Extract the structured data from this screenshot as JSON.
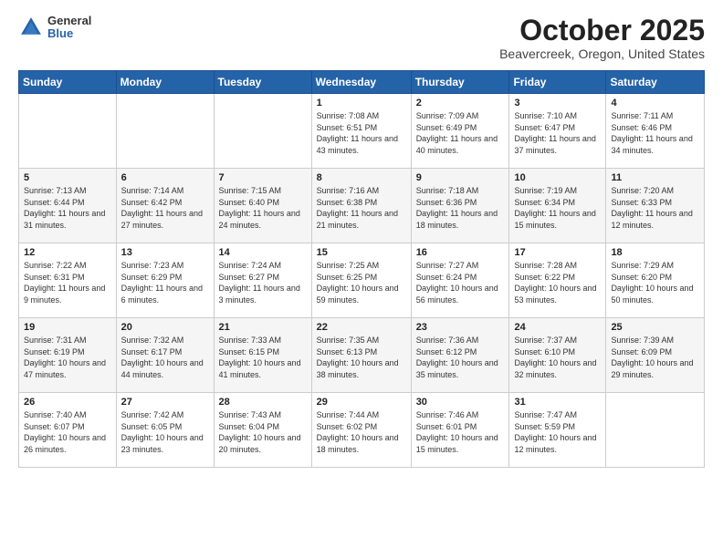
{
  "logo": {
    "general": "General",
    "blue": "Blue"
  },
  "header": {
    "month": "October 2025",
    "location": "Beavercreek, Oregon, United States"
  },
  "weekdays": [
    "Sunday",
    "Monday",
    "Tuesday",
    "Wednesday",
    "Thursday",
    "Friday",
    "Saturday"
  ],
  "weeks": [
    [
      {
        "day": "",
        "sunrise": "",
        "sunset": "",
        "daylight": ""
      },
      {
        "day": "",
        "sunrise": "",
        "sunset": "",
        "daylight": ""
      },
      {
        "day": "",
        "sunrise": "",
        "sunset": "",
        "daylight": ""
      },
      {
        "day": "1",
        "sunrise": "Sunrise: 7:08 AM",
        "sunset": "Sunset: 6:51 PM",
        "daylight": "Daylight: 11 hours and 43 minutes."
      },
      {
        "day": "2",
        "sunrise": "Sunrise: 7:09 AM",
        "sunset": "Sunset: 6:49 PM",
        "daylight": "Daylight: 11 hours and 40 minutes."
      },
      {
        "day": "3",
        "sunrise": "Sunrise: 7:10 AM",
        "sunset": "Sunset: 6:47 PM",
        "daylight": "Daylight: 11 hours and 37 minutes."
      },
      {
        "day": "4",
        "sunrise": "Sunrise: 7:11 AM",
        "sunset": "Sunset: 6:46 PM",
        "daylight": "Daylight: 11 hours and 34 minutes."
      }
    ],
    [
      {
        "day": "5",
        "sunrise": "Sunrise: 7:13 AM",
        "sunset": "Sunset: 6:44 PM",
        "daylight": "Daylight: 11 hours and 31 minutes."
      },
      {
        "day": "6",
        "sunrise": "Sunrise: 7:14 AM",
        "sunset": "Sunset: 6:42 PM",
        "daylight": "Daylight: 11 hours and 27 minutes."
      },
      {
        "day": "7",
        "sunrise": "Sunrise: 7:15 AM",
        "sunset": "Sunset: 6:40 PM",
        "daylight": "Daylight: 11 hours and 24 minutes."
      },
      {
        "day": "8",
        "sunrise": "Sunrise: 7:16 AM",
        "sunset": "Sunset: 6:38 PM",
        "daylight": "Daylight: 11 hours and 21 minutes."
      },
      {
        "day": "9",
        "sunrise": "Sunrise: 7:18 AM",
        "sunset": "Sunset: 6:36 PM",
        "daylight": "Daylight: 11 hours and 18 minutes."
      },
      {
        "day": "10",
        "sunrise": "Sunrise: 7:19 AM",
        "sunset": "Sunset: 6:34 PM",
        "daylight": "Daylight: 11 hours and 15 minutes."
      },
      {
        "day": "11",
        "sunrise": "Sunrise: 7:20 AM",
        "sunset": "Sunset: 6:33 PM",
        "daylight": "Daylight: 11 hours and 12 minutes."
      }
    ],
    [
      {
        "day": "12",
        "sunrise": "Sunrise: 7:22 AM",
        "sunset": "Sunset: 6:31 PM",
        "daylight": "Daylight: 11 hours and 9 minutes."
      },
      {
        "day": "13",
        "sunrise": "Sunrise: 7:23 AM",
        "sunset": "Sunset: 6:29 PM",
        "daylight": "Daylight: 11 hours and 6 minutes."
      },
      {
        "day": "14",
        "sunrise": "Sunrise: 7:24 AM",
        "sunset": "Sunset: 6:27 PM",
        "daylight": "Daylight: 11 hours and 3 minutes."
      },
      {
        "day": "15",
        "sunrise": "Sunrise: 7:25 AM",
        "sunset": "Sunset: 6:25 PM",
        "daylight": "Daylight: 10 hours and 59 minutes."
      },
      {
        "day": "16",
        "sunrise": "Sunrise: 7:27 AM",
        "sunset": "Sunset: 6:24 PM",
        "daylight": "Daylight: 10 hours and 56 minutes."
      },
      {
        "day": "17",
        "sunrise": "Sunrise: 7:28 AM",
        "sunset": "Sunset: 6:22 PM",
        "daylight": "Daylight: 10 hours and 53 minutes."
      },
      {
        "day": "18",
        "sunrise": "Sunrise: 7:29 AM",
        "sunset": "Sunset: 6:20 PM",
        "daylight": "Daylight: 10 hours and 50 minutes."
      }
    ],
    [
      {
        "day": "19",
        "sunrise": "Sunrise: 7:31 AM",
        "sunset": "Sunset: 6:19 PM",
        "daylight": "Daylight: 10 hours and 47 minutes."
      },
      {
        "day": "20",
        "sunrise": "Sunrise: 7:32 AM",
        "sunset": "Sunset: 6:17 PM",
        "daylight": "Daylight: 10 hours and 44 minutes."
      },
      {
        "day": "21",
        "sunrise": "Sunrise: 7:33 AM",
        "sunset": "Sunset: 6:15 PM",
        "daylight": "Daylight: 10 hours and 41 minutes."
      },
      {
        "day": "22",
        "sunrise": "Sunrise: 7:35 AM",
        "sunset": "Sunset: 6:13 PM",
        "daylight": "Daylight: 10 hours and 38 minutes."
      },
      {
        "day": "23",
        "sunrise": "Sunrise: 7:36 AM",
        "sunset": "Sunset: 6:12 PM",
        "daylight": "Daylight: 10 hours and 35 minutes."
      },
      {
        "day": "24",
        "sunrise": "Sunrise: 7:37 AM",
        "sunset": "Sunset: 6:10 PM",
        "daylight": "Daylight: 10 hours and 32 minutes."
      },
      {
        "day": "25",
        "sunrise": "Sunrise: 7:39 AM",
        "sunset": "Sunset: 6:09 PM",
        "daylight": "Daylight: 10 hours and 29 minutes."
      }
    ],
    [
      {
        "day": "26",
        "sunrise": "Sunrise: 7:40 AM",
        "sunset": "Sunset: 6:07 PM",
        "daylight": "Daylight: 10 hours and 26 minutes."
      },
      {
        "day": "27",
        "sunrise": "Sunrise: 7:42 AM",
        "sunset": "Sunset: 6:05 PM",
        "daylight": "Daylight: 10 hours and 23 minutes."
      },
      {
        "day": "28",
        "sunrise": "Sunrise: 7:43 AM",
        "sunset": "Sunset: 6:04 PM",
        "daylight": "Daylight: 10 hours and 20 minutes."
      },
      {
        "day": "29",
        "sunrise": "Sunrise: 7:44 AM",
        "sunset": "Sunset: 6:02 PM",
        "daylight": "Daylight: 10 hours and 18 minutes."
      },
      {
        "day": "30",
        "sunrise": "Sunrise: 7:46 AM",
        "sunset": "Sunset: 6:01 PM",
        "daylight": "Daylight: 10 hours and 15 minutes."
      },
      {
        "day": "31",
        "sunrise": "Sunrise: 7:47 AM",
        "sunset": "Sunset: 5:59 PM",
        "daylight": "Daylight: 10 hours and 12 minutes."
      },
      {
        "day": "",
        "sunrise": "",
        "sunset": "",
        "daylight": ""
      }
    ]
  ]
}
